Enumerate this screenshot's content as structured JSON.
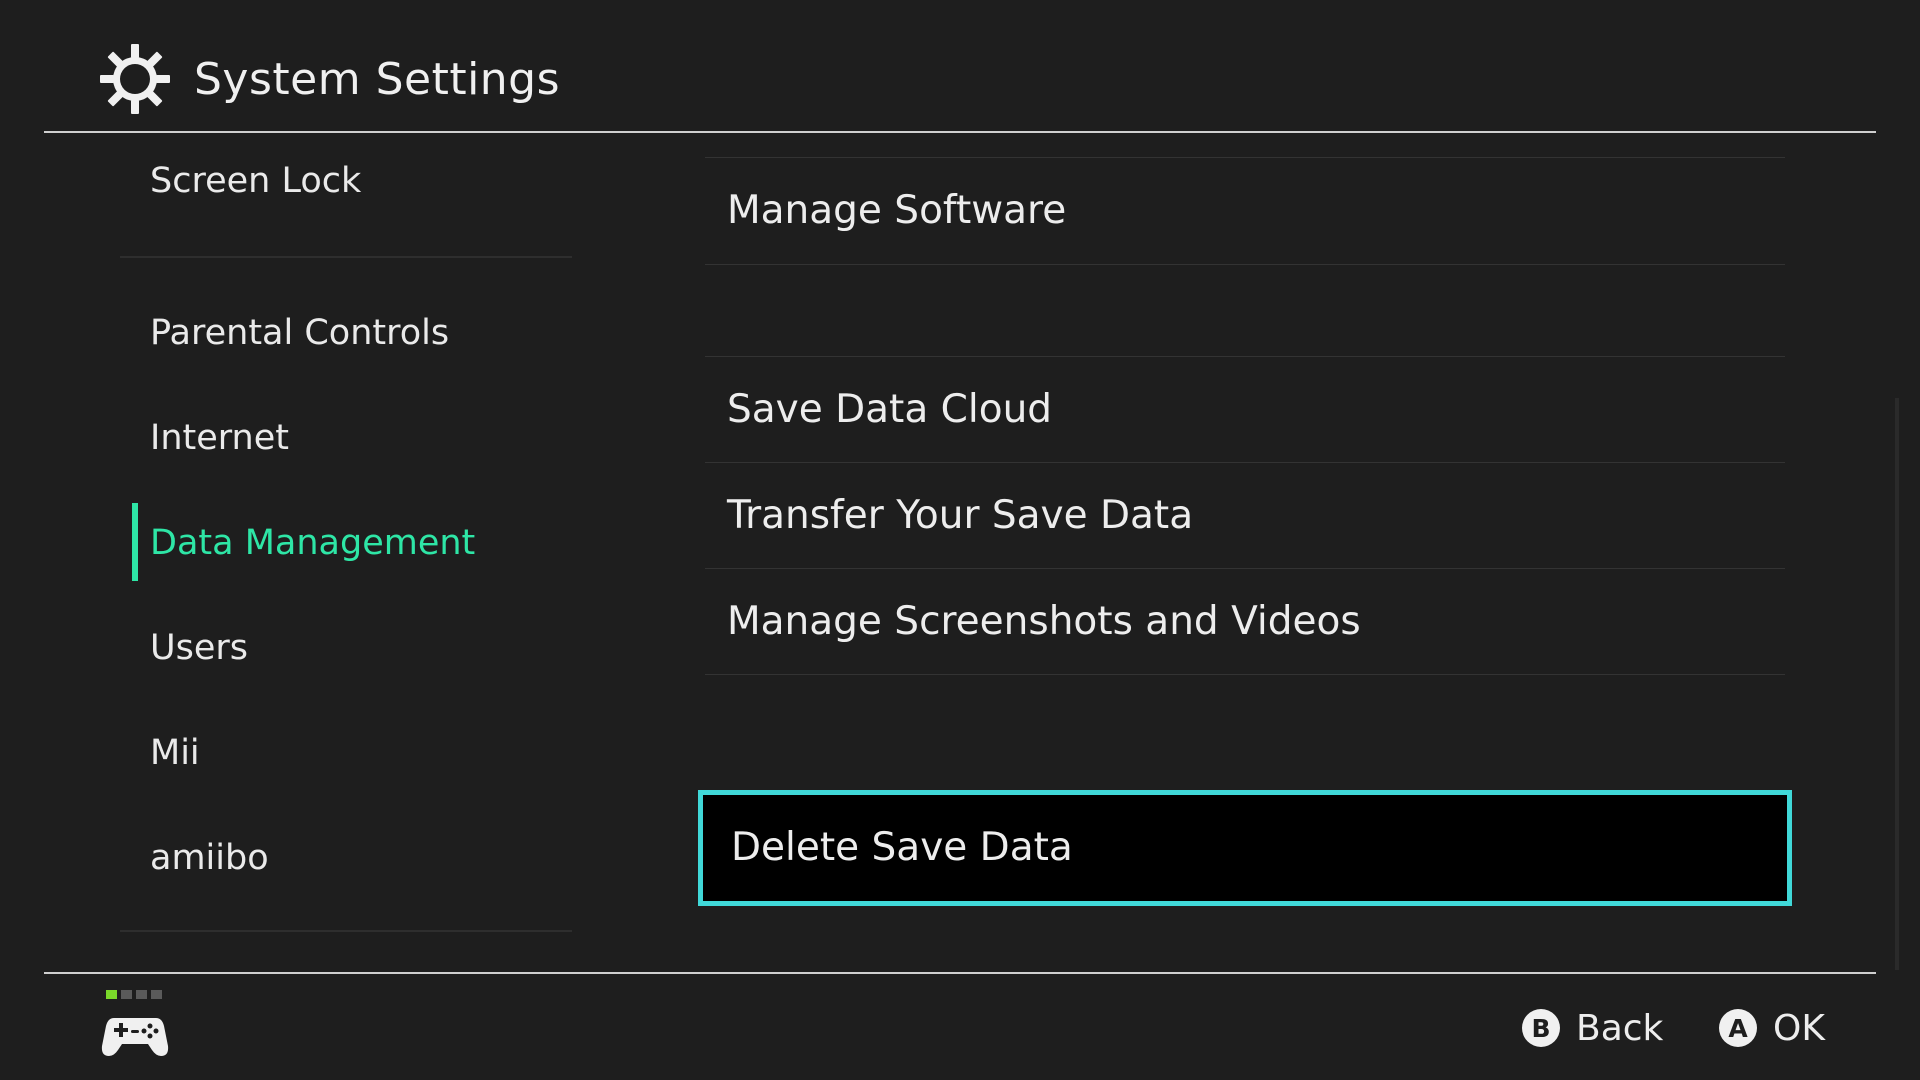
{
  "header": {
    "title": "System Settings",
    "icon": "gear-icon"
  },
  "sidebar": {
    "items": [
      {
        "label": "Screen Lock"
      },
      {
        "label": "Parental Controls"
      },
      {
        "label": "Internet"
      },
      {
        "label": "Data Management",
        "selected": true
      },
      {
        "label": "Users"
      },
      {
        "label": "Mii"
      },
      {
        "label": "amiibo"
      }
    ],
    "accent_color": "#2ee6a6"
  },
  "content": {
    "items": [
      {
        "label": "Manage Software"
      },
      {
        "label": "Save Data Cloud"
      },
      {
        "label": "Transfer Your Save Data"
      },
      {
        "label": "Manage Screenshots and Videos"
      },
      {
        "label": "Delete Save Data",
        "focused": true
      }
    ],
    "focus_color": "#40d8d8"
  },
  "footer": {
    "player_indicator": {
      "active_player": 1,
      "total": 4,
      "active_color": "#7ad82a"
    },
    "controller_icon": "controller-icon",
    "hints": [
      {
        "button": "B",
        "label": "Back"
      },
      {
        "button": "A",
        "label": "OK"
      }
    ]
  }
}
